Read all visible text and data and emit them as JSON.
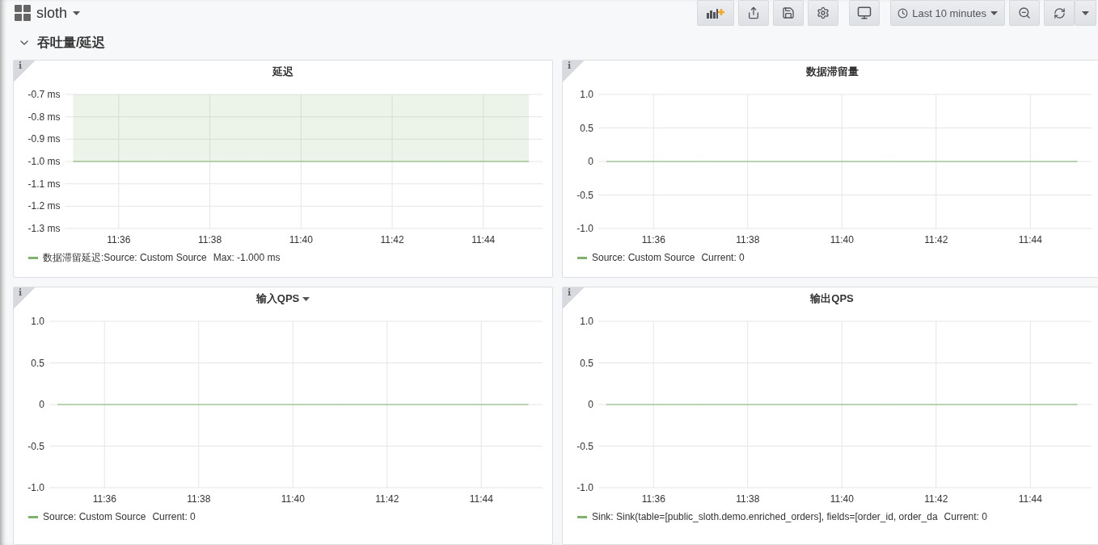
{
  "dashboard": {
    "title": "sloth"
  },
  "toolbar": {
    "time_range": "Last 10 minutes"
  },
  "row": {
    "title": "吞吐量/延迟",
    "expanded": true
  },
  "panels": [
    {
      "title": "延迟",
      "info_mark": "i",
      "has_menu": false,
      "legend_stat": "Max: -1.000 ms",
      "chart_data": {
        "type": "area",
        "grid": true,
        "ylim": [
          -1.3,
          -0.7
        ],
        "yticks": [
          {
            "value": -0.7,
            "label": "-0.7 ms"
          },
          {
            "value": -0.8,
            "label": "-0.8 ms"
          },
          {
            "value": -0.9,
            "label": "-0.9 ms"
          },
          {
            "value": -1.0,
            "label": "-1.0 ms"
          },
          {
            "value": -1.1,
            "label": "-1.1 ms"
          },
          {
            "value": -1.2,
            "label": "-1.2 ms"
          },
          {
            "value": -1.3,
            "label": "-1.3 ms"
          }
        ],
        "categories": [
          null,
          "11:36",
          null,
          "11:38",
          null,
          "11:40",
          null,
          "11:42",
          null,
          "11:44",
          null
        ],
        "series": [
          {
            "name": "数据滞留延迟:Source: Custom Source",
            "color": "#7eb26d",
            "values": [
              -1.0,
              -1.0,
              -1.0,
              -1.0,
              -1.0,
              -1.0,
              -1.0,
              -1.0,
              -1.0,
              -1.0,
              -1.0
            ]
          }
        ]
      }
    },
    {
      "title": "数据滞留量",
      "info_mark": "i",
      "has_menu": false,
      "legend_stat": "Current: 0",
      "chart_data": {
        "type": "line",
        "grid": true,
        "ylim": [
          -1,
          1
        ],
        "yticks": [
          {
            "value": 1,
            "label": "1.0"
          },
          {
            "value": 0.5,
            "label": "0.5"
          },
          {
            "value": 0,
            "label": "0"
          },
          {
            "value": -0.5,
            "label": "-0.5"
          },
          {
            "value": -1,
            "label": "-1.0"
          }
        ],
        "categories": [
          null,
          "11:36",
          null,
          "11:38",
          null,
          "11:40",
          null,
          "11:42",
          null,
          "11:44",
          null
        ],
        "series": [
          {
            "name": "Source: Custom Source",
            "color": "#7eb26d",
            "values": [
              0,
              0,
              0,
              0,
              0,
              0,
              0,
              0,
              0,
              0,
              0
            ]
          }
        ]
      }
    },
    {
      "title": "输入QPS",
      "info_mark": "i",
      "has_menu": true,
      "legend_stat": "Current: 0",
      "chart_data": {
        "type": "line",
        "grid": true,
        "ylim": [
          -1,
          1
        ],
        "yticks": [
          {
            "value": 1,
            "label": "1.0"
          },
          {
            "value": 0.5,
            "label": "0.5"
          },
          {
            "value": 0,
            "label": "0"
          },
          {
            "value": -0.5,
            "label": "-0.5"
          },
          {
            "value": -1,
            "label": "-1.0"
          }
        ],
        "categories": [
          null,
          "11:36",
          null,
          "11:38",
          null,
          "11:40",
          null,
          "11:42",
          null,
          "11:44",
          null
        ],
        "series": [
          {
            "name": "Source: Custom Source",
            "color": "#7eb26d",
            "values": [
              0,
              0,
              0,
              0,
              0,
              0,
              0,
              0,
              0,
              0,
              0
            ]
          }
        ]
      }
    },
    {
      "title": "输出QPS",
      "info_mark": "i",
      "has_menu": false,
      "legend_stat": "Current: 0",
      "chart_data": {
        "type": "line",
        "grid": true,
        "ylim": [
          -1,
          1
        ],
        "yticks": [
          {
            "value": 1,
            "label": "1.0"
          },
          {
            "value": 0.5,
            "label": "0.5"
          },
          {
            "value": 0,
            "label": "0"
          },
          {
            "value": -0.5,
            "label": "-0.5"
          },
          {
            "value": -1,
            "label": "-1.0"
          }
        ],
        "categories": [
          null,
          "11:36",
          null,
          "11:38",
          null,
          "11:40",
          null,
          "11:42",
          null,
          "11:44",
          null
        ],
        "series": [
          {
            "name": "Sink: Sink(table=[public_sloth.demo.enriched_orders], fields=[order_id, order_da",
            "color": "#7eb26d",
            "values": [
              0,
              0,
              0,
              0,
              0,
              0,
              0,
              0,
              0,
              0,
              0
            ]
          }
        ]
      }
    }
  ]
}
